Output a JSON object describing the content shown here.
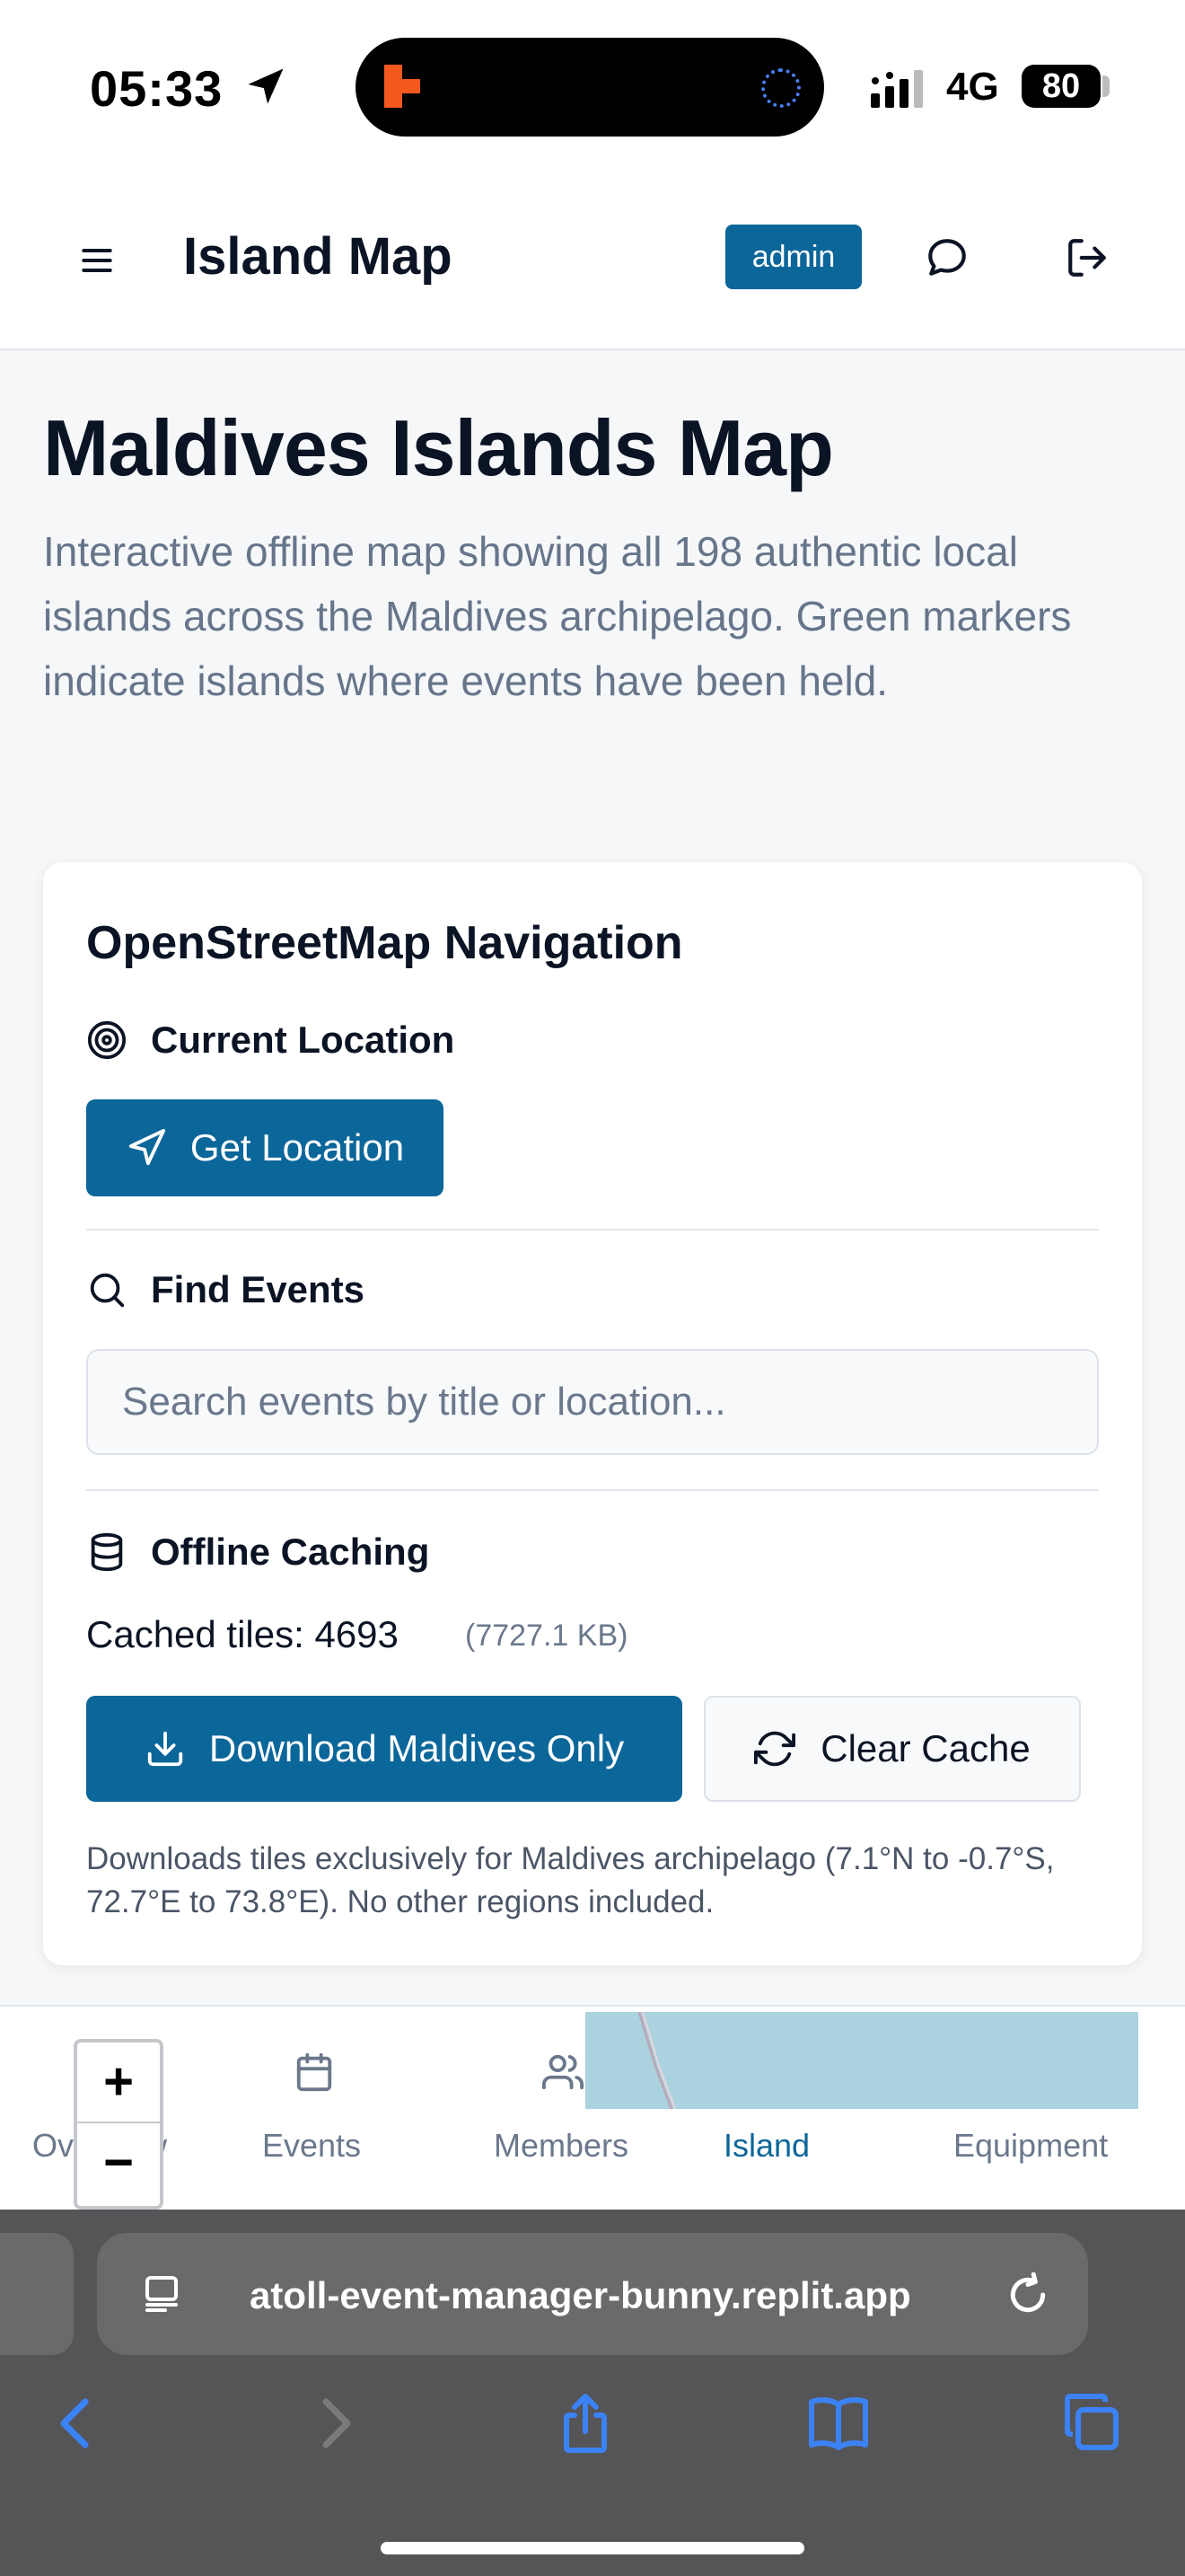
{
  "status_bar": {
    "time": "05:33",
    "network": "4G",
    "battery": "80"
  },
  "header": {
    "title": "Island Map",
    "role_badge": "admin"
  },
  "intro": {
    "title": "Maldives Islands Map",
    "description": "Interactive offline map showing all 198 authentic local islands across the Maldives archipelago. Green markers indicate islands where events have been held."
  },
  "nav_card": {
    "title": "OpenStreetMap Navigation",
    "current_location": {
      "heading": "Current Location",
      "button": "Get Location"
    },
    "find_events": {
      "heading": "Find Events",
      "placeholder": "Search events by title or location..."
    },
    "offline_caching": {
      "heading": "Offline Caching",
      "cached_tiles_label": "Cached tiles: 4693",
      "cached_size": "(7727.1 KB)",
      "download_button": "Download Maldives Only",
      "clear_button": "Clear Cache",
      "note": "Downloads tiles exclusively for Maldives archipelago (7.1°N to -0.7°S, 72.7°E to 73.8°E). No other regions included."
    }
  },
  "tab_bar": {
    "items": [
      {
        "label": "Overview",
        "icon": "layout-icon",
        "active": false
      },
      {
        "label": "Events",
        "icon": "calendar-icon",
        "active": false
      },
      {
        "label": "Members",
        "icon": "users-icon",
        "active": false
      },
      {
        "label": "Island",
        "icon": "map-icon",
        "active": true
      },
      {
        "label": "Equipment",
        "icon": "box-icon",
        "active": false
      }
    ]
  },
  "map_controls": {
    "zoom_in": "+",
    "zoom_out": "−"
  },
  "browser": {
    "url": "atoll-event-manager-bunny.replit.app"
  },
  "colors": {
    "primary": "#0b6699",
    "text": "#0b1424",
    "muted": "#66758a",
    "map_water": "#aad3df"
  }
}
